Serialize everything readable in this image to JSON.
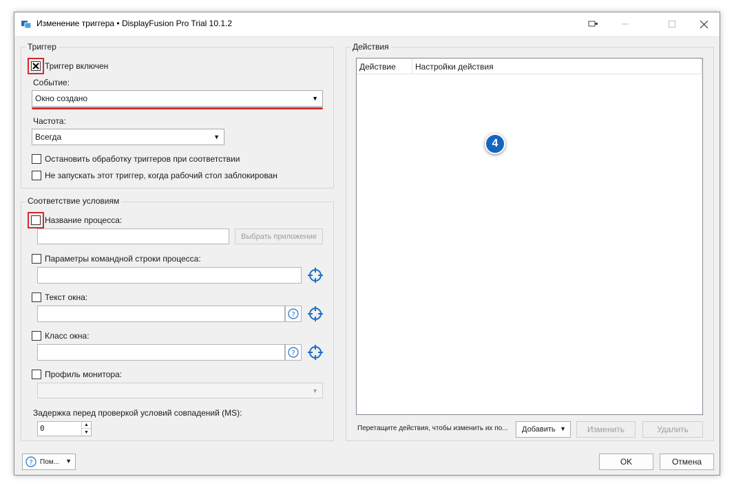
{
  "window": {
    "title": "Изменение триггера • DisplayFusion Pro Trial 10.1.2"
  },
  "trigger_group": {
    "legend": "Триггер",
    "enabled_label": "Триггер включен",
    "enabled_checked": true,
    "event_label": "Событие:",
    "event_value": "Окно создано",
    "frequency_label": "Частота:",
    "frequency_value": "Всегда",
    "stop_processing_label": "Остановить обработку триггеров при соответствии",
    "no_run_locked_label": "Не запускать этот триггер, когда рабочий стол заблокирован"
  },
  "conditions_group": {
    "legend": "Соответствие условиям",
    "process_name_label": "Название процесса:",
    "choose_app_label": "Выбрать приложение",
    "cmdline_label": "Параметры командной строки процесса:",
    "window_text_label": "Текст окна:",
    "window_class_label": "Класс окна:",
    "monitor_profile_label": "Профиль монитора:",
    "delay_label": "Задержка перед проверкой условий совпадений (MS):",
    "delay_value": "0"
  },
  "actions_group": {
    "legend": "Действия",
    "columns": [
      "Действие",
      "Настройки действия"
    ],
    "badge": "4",
    "drag_hint": "Перетащите действия, чтобы изменить их по...",
    "add_label": "Добавить",
    "edit_label": "Изменить",
    "delete_label": "Удалить"
  },
  "footer": {
    "help_label": "Пом...",
    "ok_label": "OK",
    "cancel_label": "Отмена"
  },
  "colors": {
    "annotation_red": "#d9262b",
    "target_blue": "#1a6fc4",
    "badge_blue": "#1565c0"
  }
}
